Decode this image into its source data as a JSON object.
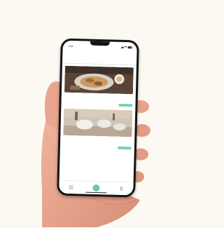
{
  "phone": {
    "status": {
      "time": "9:41",
      "signal_icon": "signal-icon",
      "wifi_icon": "wifi-icon",
      "battery_icon": "battery-icon"
    },
    "header": {
      "left": "",
      "right": ""
    },
    "tabs": [
      {
        "label": "",
        "active": false
      },
      {
        "label": "",
        "active": true
      }
    ],
    "cards": [
      {
        "title": "",
        "subtitle": "",
        "meta": "",
        "button": "",
        "image_theme": "food"
      },
      {
        "title": "",
        "subtitle": "",
        "meta": "",
        "button": "",
        "image_theme": "table"
      }
    ],
    "bottom_nav": [
      {
        "icon": "list-icon"
      },
      {
        "icon": "add-icon"
      },
      {
        "icon": "profile-icon"
      }
    ]
  },
  "colors": {
    "background": "#fcf9f3",
    "accent": "#6fc6a6",
    "phone_frame": "#141414",
    "skin": "#e7a28b"
  }
}
